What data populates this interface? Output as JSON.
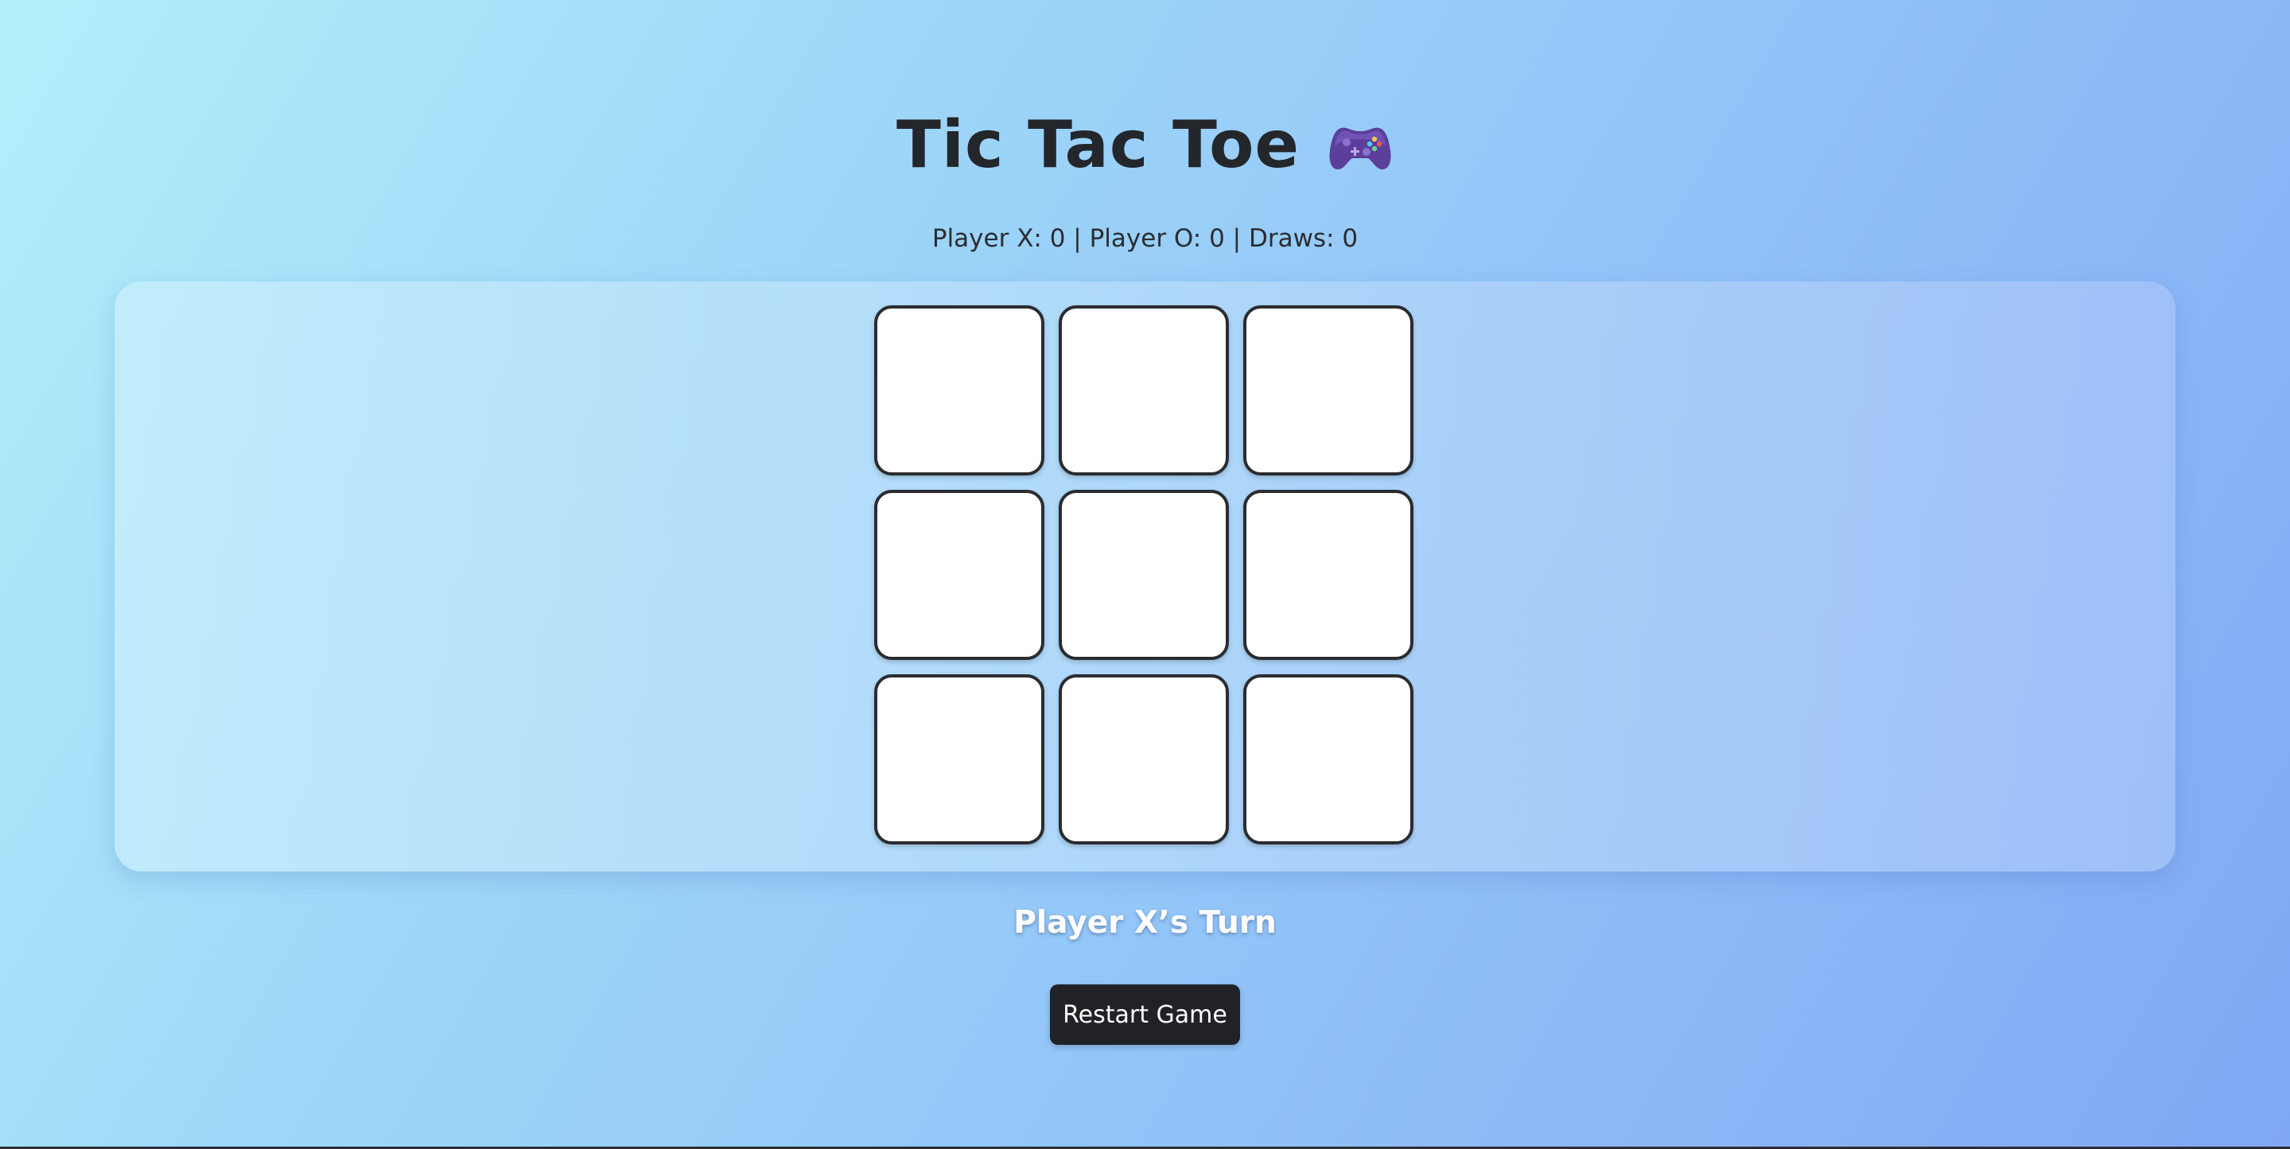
{
  "title": "Tic Tac Toe",
  "title_icon": "gamepad-icon",
  "score": {
    "text": "Player X: 0 | Player O: 0 | Draws: 0",
    "player_x": 0,
    "player_o": 0,
    "draws": 0
  },
  "board": {
    "cells": [
      "",
      "",
      "",
      "",
      "",
      "",
      "",
      "",
      ""
    ]
  },
  "status": "Player X’s Turn",
  "restart_label": "Restart Game",
  "colors": {
    "background_start": "#b1f0fa",
    "background_end": "#81a8f4",
    "cell_fill": "#ffffff",
    "cell_border": "#2a2c30",
    "button": "#212226",
    "status_text": "#ffffff",
    "gamepad": "#5b3f9a"
  }
}
